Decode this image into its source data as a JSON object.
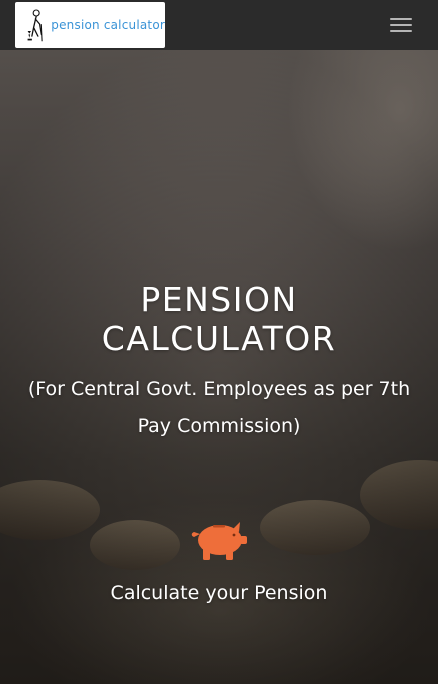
{
  "navbar": {
    "brand_text": "pension calculator",
    "toggle_icon": "hamburger-menu-icon"
  },
  "hero": {
    "title_line1": "PENSION",
    "title_line2": "CALCULATOR",
    "subtitle": "(For Central Govt. Employees as per 7th Pay Commission)",
    "piggy_icon": "piggy-bank-icon",
    "cta_label": "Calculate your Pension"
  },
  "colors": {
    "navbar_bg": "#2b2b2b",
    "brand_text": "#3a93d6",
    "accent_piggy": "#ee6e3a"
  }
}
